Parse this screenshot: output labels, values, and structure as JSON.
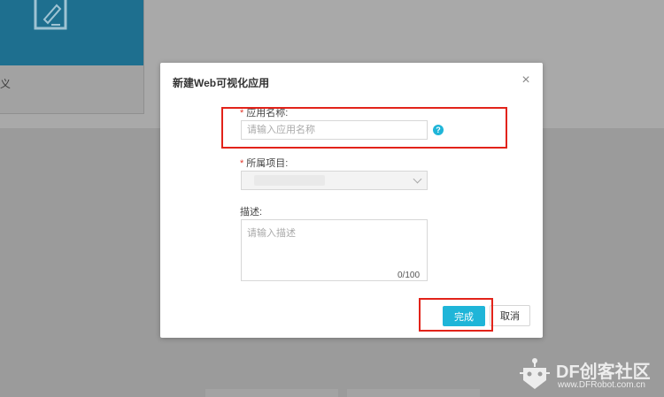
{
  "background": {
    "card_text": "义"
  },
  "modal": {
    "title": "新建Web可视化应用",
    "close_symbol": "×",
    "fields": {
      "app_name": {
        "label": "应用名称:",
        "placeholder": "请输入应用名称",
        "help": "?"
      },
      "project": {
        "label": "所属项目:"
      },
      "description": {
        "label": "描述:",
        "placeholder": "请输入描述",
        "counter": "0/100"
      }
    },
    "buttons": {
      "submit": "完成",
      "cancel": "取消"
    }
  },
  "watermark": {
    "title": "DF创客社区",
    "subtitle": "www.DFRobot.com.cn"
  },
  "colors": {
    "accent": "#1fb5d8",
    "highlight": "#e2231a",
    "required": "#e23b2e"
  }
}
